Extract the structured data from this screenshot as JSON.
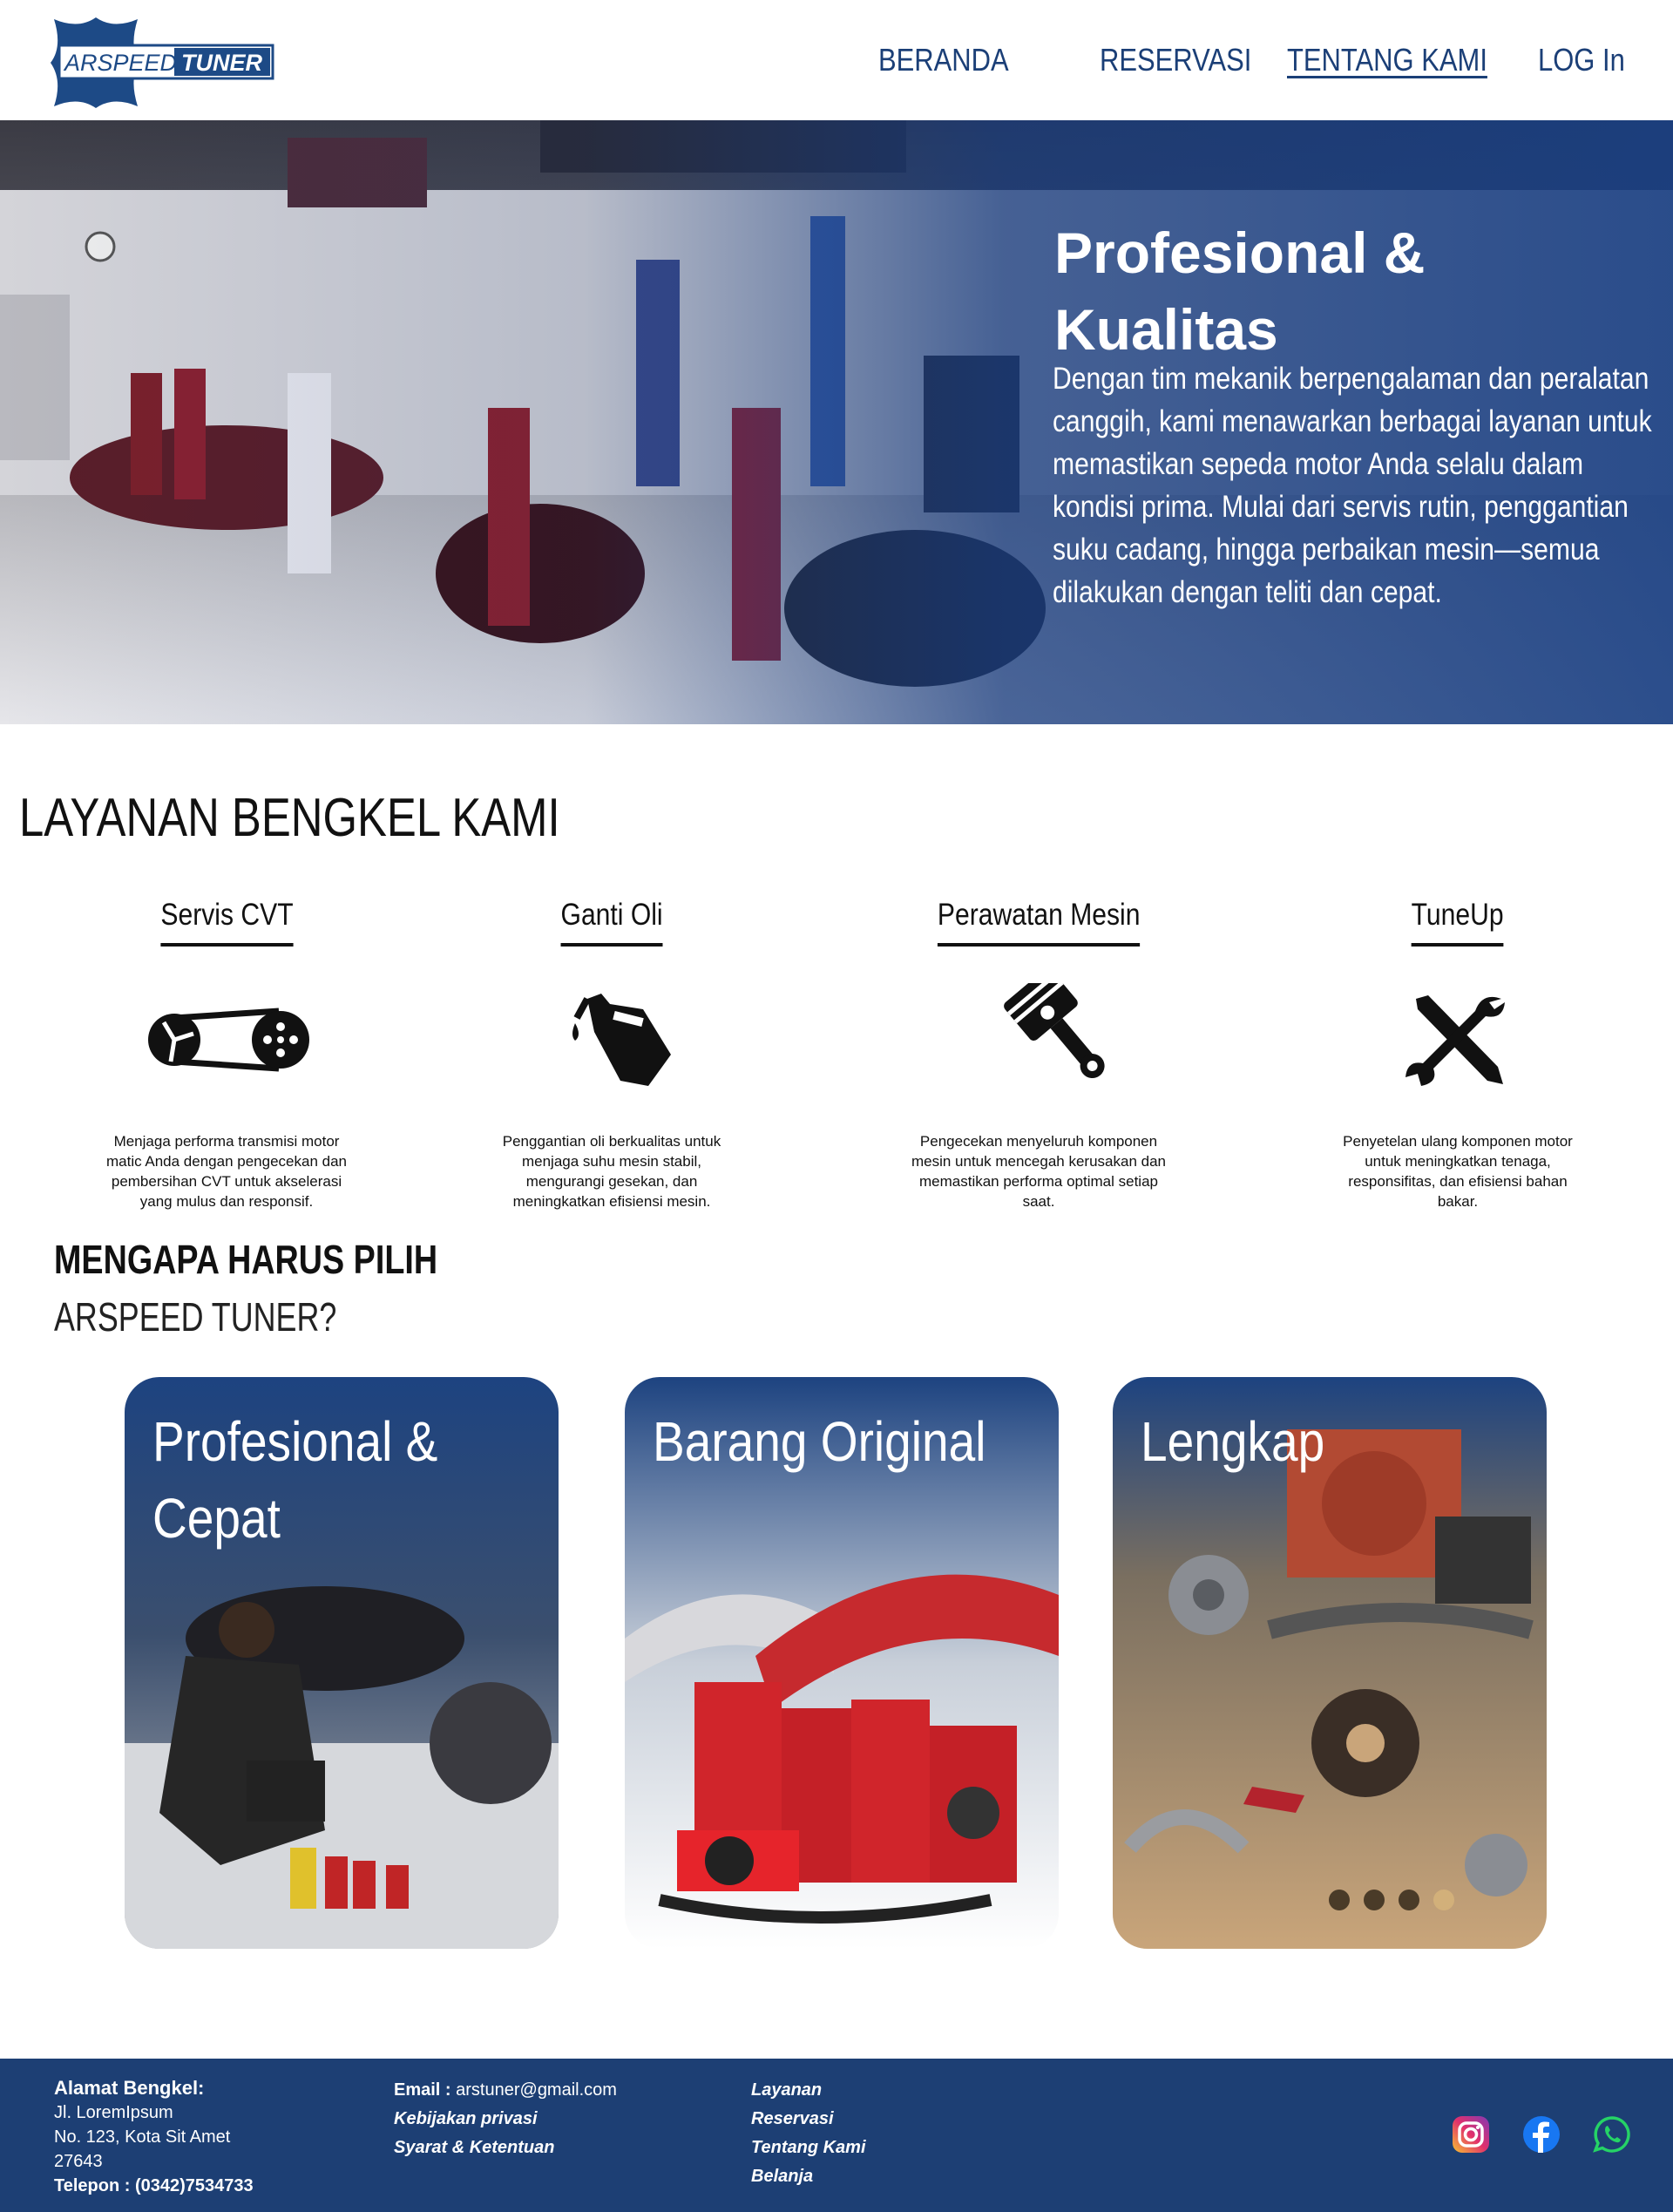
{
  "nav": {
    "brand_left": "ARSPEED",
    "brand_right": "TUNER",
    "links": [
      {
        "label": "BERANDA"
      },
      {
        "label": "RESERVASI"
      },
      {
        "label": "TENTANG KAMI"
      },
      {
        "label": "LOG In"
      }
    ]
  },
  "hero": {
    "title": "Profesional & Kualitas",
    "text": "Dengan tim mekanik berpengalaman dan peralatan canggih, kami menawarkan berbagai layanan untuk memastikan sepeda motor Anda selalu dalam kondisi prima. Mulai dari servis rutin, penggantian suku cadang, hingga perbaikan mesin—semua dilakukan dengan teliti dan cepat."
  },
  "services": {
    "title": "LAYANAN BENGKEL KAMI",
    "items": [
      {
        "name": "Servis CVT",
        "icon": "cvt-belt-icon",
        "desc": "Menjaga performa transmisi motor matic Anda dengan pengecekan dan pembersihan CVT untuk akselerasi yang mulus dan responsif."
      },
      {
        "name": "Ganti Oli",
        "icon": "oil-can-icon",
        "desc": "Penggantian oli berkualitas untuk menjaga suhu mesin stabil, mengurangi gesekan, dan meningkatkan efisiensi mesin."
      },
      {
        "name": "Perawatan Mesin",
        "icon": "piston-icon",
        "desc": "Pengecekan menyeluruh komponen mesin untuk mencegah kerusakan dan memastikan performa optimal setiap saat."
      },
      {
        "name": "TuneUp",
        "icon": "wrench-screwdriver-icon",
        "desc": "Penyetelan ulang komponen motor untuk meningkatkan tenaga, responsifitas, dan efisiensi bahan bakar."
      }
    ]
  },
  "why": {
    "line1": "MENGAPA  HARUS PILIH",
    "line2": "ARSPEED TUNER?",
    "cards": [
      {
        "title": "Profesional & Cepat"
      },
      {
        "title": "Barang Original"
      },
      {
        "title": "Lengkap"
      }
    ]
  },
  "footer": {
    "address_label": "Alamat Bengkel:",
    "address_lines": [
      "Jl. LoremIpsum",
      "No. 123, Kota Sit Amet",
      "27643"
    ],
    "phone_label": "Telepon : ",
    "phone": "(0342)7534733",
    "email_label": "Email : ",
    "email": "arstuner@gmail.com",
    "policy": "Kebijakan privasi",
    "terms": "Syarat & Ketentuan",
    "links": [
      "Layanan",
      "Reservasi",
      "Tentang Kami",
      "Belanja"
    ],
    "social": [
      "instagram-icon",
      "facebook-icon",
      "whatsapp-icon"
    ]
  }
}
